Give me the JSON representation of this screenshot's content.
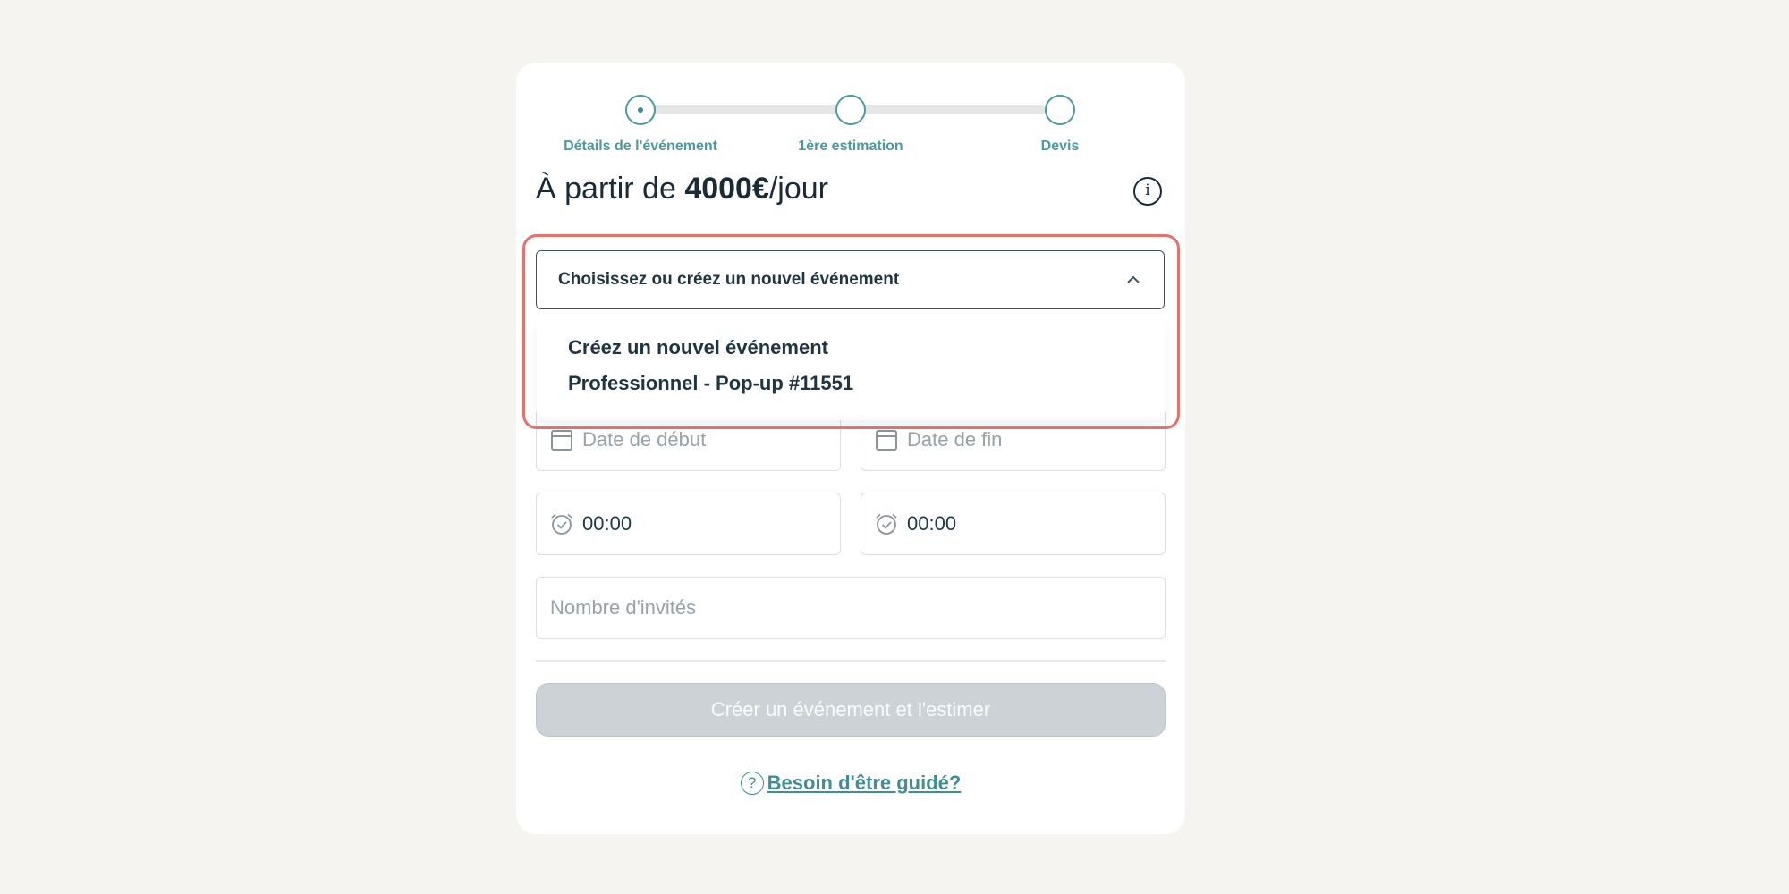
{
  "stepper": {
    "steps": [
      {
        "label": "Détails de l'événement",
        "active": true
      },
      {
        "label": "1ère estimation",
        "active": false
      },
      {
        "label": "Devis",
        "active": false
      }
    ]
  },
  "price": {
    "prefix": "À partir de ",
    "amount": "4000€",
    "suffix": "/jour"
  },
  "event_select": {
    "placeholder": "Choisissez ou créez un nouvel événement",
    "options": [
      "Créez un nouvel événement",
      "Professionnel - Pop-up #11551"
    ]
  },
  "form": {
    "start_date_placeholder": "Date de début",
    "end_date_placeholder": "Date de fin",
    "start_time": "00:00",
    "end_time": "00:00",
    "guests_placeholder": "Nombre d'invités"
  },
  "submit_label": "Créer un événement et l'estimer",
  "help_label": "Besoin d'être guidé?",
  "colors": {
    "accent": "#4a9aa0",
    "highlight": "#e8706c",
    "disabled_button": "#cdd2d6"
  }
}
